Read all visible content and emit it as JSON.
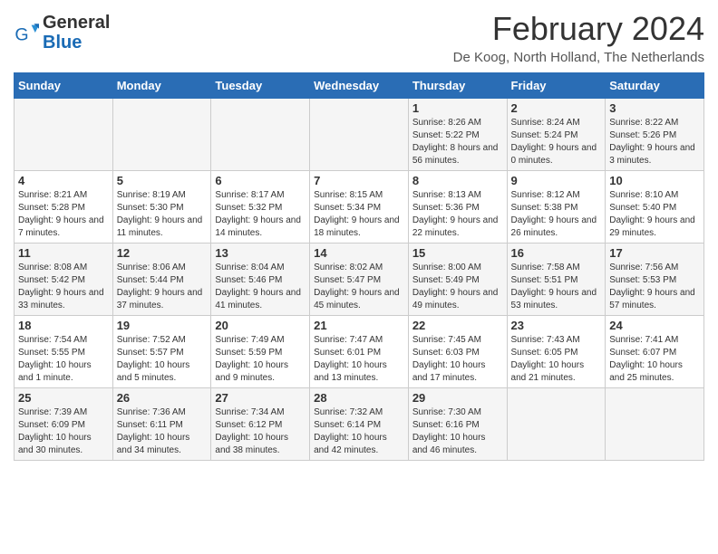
{
  "logo": {
    "general": "General",
    "blue": "Blue"
  },
  "title": "February 2024",
  "location": "De Koog, North Holland, The Netherlands",
  "weekdays": [
    "Sunday",
    "Monday",
    "Tuesday",
    "Wednesday",
    "Thursday",
    "Friday",
    "Saturday"
  ],
  "weeks": [
    [
      {
        "day": "",
        "info": ""
      },
      {
        "day": "",
        "info": ""
      },
      {
        "day": "",
        "info": ""
      },
      {
        "day": "",
        "info": ""
      },
      {
        "day": "1",
        "info": "Sunrise: 8:26 AM\nSunset: 5:22 PM\nDaylight: 8 hours and 56 minutes."
      },
      {
        "day": "2",
        "info": "Sunrise: 8:24 AM\nSunset: 5:24 PM\nDaylight: 9 hours and 0 minutes."
      },
      {
        "day": "3",
        "info": "Sunrise: 8:22 AM\nSunset: 5:26 PM\nDaylight: 9 hours and 3 minutes."
      }
    ],
    [
      {
        "day": "4",
        "info": "Sunrise: 8:21 AM\nSunset: 5:28 PM\nDaylight: 9 hours and 7 minutes."
      },
      {
        "day": "5",
        "info": "Sunrise: 8:19 AM\nSunset: 5:30 PM\nDaylight: 9 hours and 11 minutes."
      },
      {
        "day": "6",
        "info": "Sunrise: 8:17 AM\nSunset: 5:32 PM\nDaylight: 9 hours and 14 minutes."
      },
      {
        "day": "7",
        "info": "Sunrise: 8:15 AM\nSunset: 5:34 PM\nDaylight: 9 hours and 18 minutes."
      },
      {
        "day": "8",
        "info": "Sunrise: 8:13 AM\nSunset: 5:36 PM\nDaylight: 9 hours and 22 minutes."
      },
      {
        "day": "9",
        "info": "Sunrise: 8:12 AM\nSunset: 5:38 PM\nDaylight: 9 hours and 26 minutes."
      },
      {
        "day": "10",
        "info": "Sunrise: 8:10 AM\nSunset: 5:40 PM\nDaylight: 9 hours and 29 minutes."
      }
    ],
    [
      {
        "day": "11",
        "info": "Sunrise: 8:08 AM\nSunset: 5:42 PM\nDaylight: 9 hours and 33 minutes."
      },
      {
        "day": "12",
        "info": "Sunrise: 8:06 AM\nSunset: 5:44 PM\nDaylight: 9 hours and 37 minutes."
      },
      {
        "day": "13",
        "info": "Sunrise: 8:04 AM\nSunset: 5:46 PM\nDaylight: 9 hours and 41 minutes."
      },
      {
        "day": "14",
        "info": "Sunrise: 8:02 AM\nSunset: 5:47 PM\nDaylight: 9 hours and 45 minutes."
      },
      {
        "day": "15",
        "info": "Sunrise: 8:00 AM\nSunset: 5:49 PM\nDaylight: 9 hours and 49 minutes."
      },
      {
        "day": "16",
        "info": "Sunrise: 7:58 AM\nSunset: 5:51 PM\nDaylight: 9 hours and 53 minutes."
      },
      {
        "day": "17",
        "info": "Sunrise: 7:56 AM\nSunset: 5:53 PM\nDaylight: 9 hours and 57 minutes."
      }
    ],
    [
      {
        "day": "18",
        "info": "Sunrise: 7:54 AM\nSunset: 5:55 PM\nDaylight: 10 hours and 1 minute."
      },
      {
        "day": "19",
        "info": "Sunrise: 7:52 AM\nSunset: 5:57 PM\nDaylight: 10 hours and 5 minutes."
      },
      {
        "day": "20",
        "info": "Sunrise: 7:49 AM\nSunset: 5:59 PM\nDaylight: 10 hours and 9 minutes."
      },
      {
        "day": "21",
        "info": "Sunrise: 7:47 AM\nSunset: 6:01 PM\nDaylight: 10 hours and 13 minutes."
      },
      {
        "day": "22",
        "info": "Sunrise: 7:45 AM\nSunset: 6:03 PM\nDaylight: 10 hours and 17 minutes."
      },
      {
        "day": "23",
        "info": "Sunrise: 7:43 AM\nSunset: 6:05 PM\nDaylight: 10 hours and 21 minutes."
      },
      {
        "day": "24",
        "info": "Sunrise: 7:41 AM\nSunset: 6:07 PM\nDaylight: 10 hours and 25 minutes."
      }
    ],
    [
      {
        "day": "25",
        "info": "Sunrise: 7:39 AM\nSunset: 6:09 PM\nDaylight: 10 hours and 30 minutes."
      },
      {
        "day": "26",
        "info": "Sunrise: 7:36 AM\nSunset: 6:11 PM\nDaylight: 10 hours and 34 minutes."
      },
      {
        "day": "27",
        "info": "Sunrise: 7:34 AM\nSunset: 6:12 PM\nDaylight: 10 hours and 38 minutes."
      },
      {
        "day": "28",
        "info": "Sunrise: 7:32 AM\nSunset: 6:14 PM\nDaylight: 10 hours and 42 minutes."
      },
      {
        "day": "29",
        "info": "Sunrise: 7:30 AM\nSunset: 6:16 PM\nDaylight: 10 hours and 46 minutes."
      },
      {
        "day": "",
        "info": ""
      },
      {
        "day": "",
        "info": ""
      }
    ]
  ]
}
